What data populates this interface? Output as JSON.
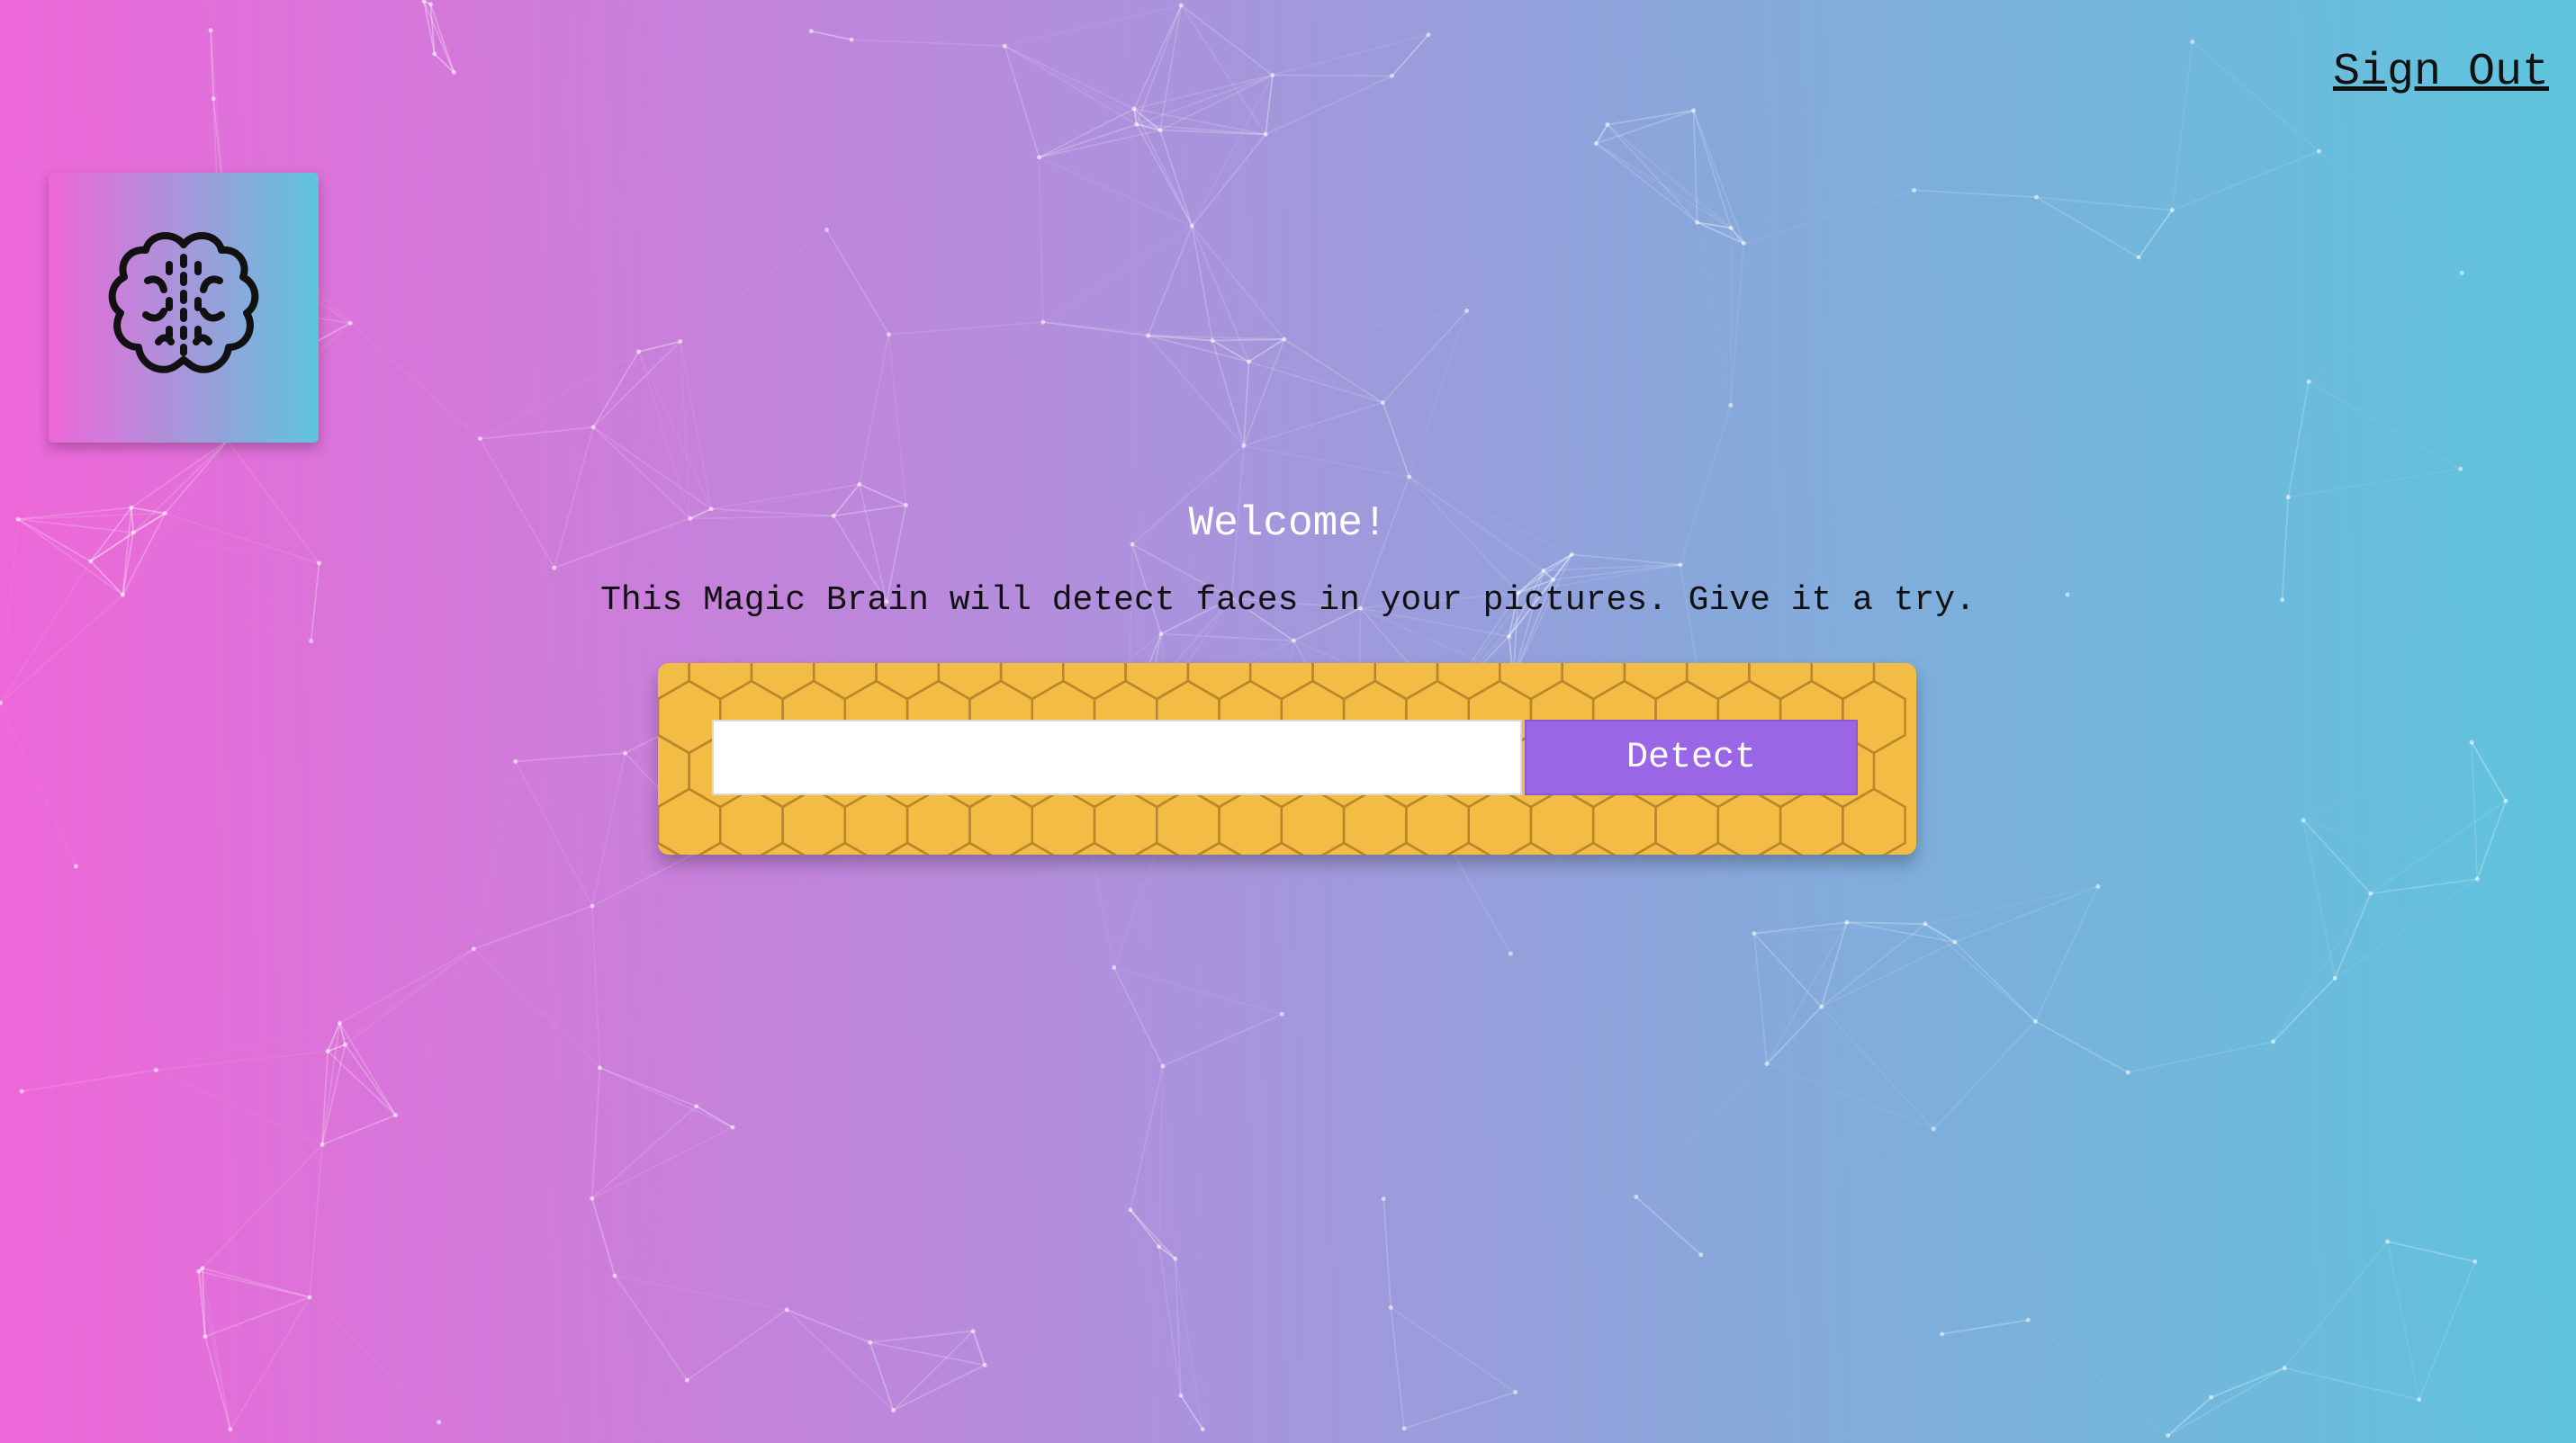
{
  "nav": {
    "sign_out_label": "Sign Out"
  },
  "logo": {
    "icon": "brain-icon"
  },
  "main": {
    "heading": "Welcome!",
    "intro": "This Magic Brain will detect faces in your pictures. Give it a try."
  },
  "image_form": {
    "url_value": "",
    "detect_label": "Detect"
  },
  "colors": {
    "gradient_start": "#ee67d8",
    "gradient_end": "#5ec5dd",
    "panel": "#f3bc45",
    "button": "#9b66e6"
  }
}
